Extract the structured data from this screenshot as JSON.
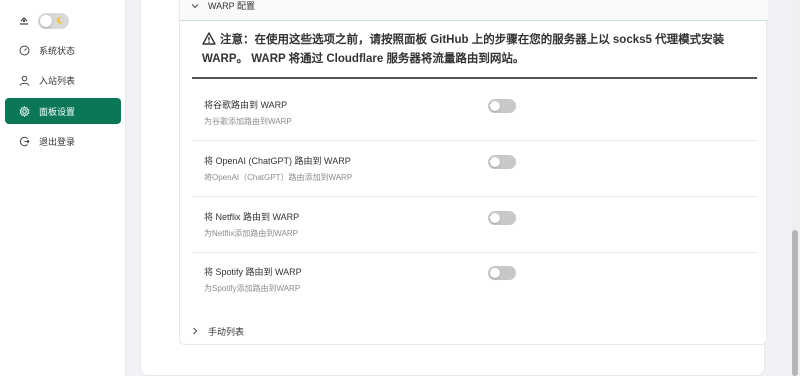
{
  "sidebar": {
    "theme_toggle": {
      "state": "off"
    },
    "items": [
      {
        "label": "系统状态",
        "icon": "dashboard-icon",
        "active": false
      },
      {
        "label": "入站列表",
        "icon": "user-icon",
        "active": false
      },
      {
        "label": "面板设置",
        "icon": "settings-icon",
        "active": true
      },
      {
        "label": "退出登录",
        "icon": "logout-icon",
        "active": false
      }
    ]
  },
  "panel": {
    "header": "WARP 配置",
    "warning": {
      "line1": "注意：在使用这些选项之前，请按照面板 GitHub 上的步骤在您的服务器上以 socks5 代理模式安装",
      "line2": "WARP。 WARP 将通过 Cloudflare 服务器将流量路由到网站。"
    },
    "settings": [
      {
        "title": "将谷歌路由到 WARP",
        "desc": "为谷歌添加路由到WARP",
        "enabled": false
      },
      {
        "title": "将 OpenAI (ChatGPT) 路由到 WARP",
        "desc": "将OpenAI（ChatGPT）路由添加到WARP",
        "enabled": false
      },
      {
        "title": "将 Netflix 路由到 WARP",
        "desc": "为Netflix添加路由到WARP",
        "enabled": false
      },
      {
        "title": "将 Spotify 路由到 WARP",
        "desc": "为Spotify添加路由到WARP",
        "enabled": false
      }
    ],
    "collapsed_section": "手动列表"
  },
  "colors": {
    "accent": "#0a7856",
    "switch_off": "#c8c8c8",
    "warning_border": "#555555"
  }
}
